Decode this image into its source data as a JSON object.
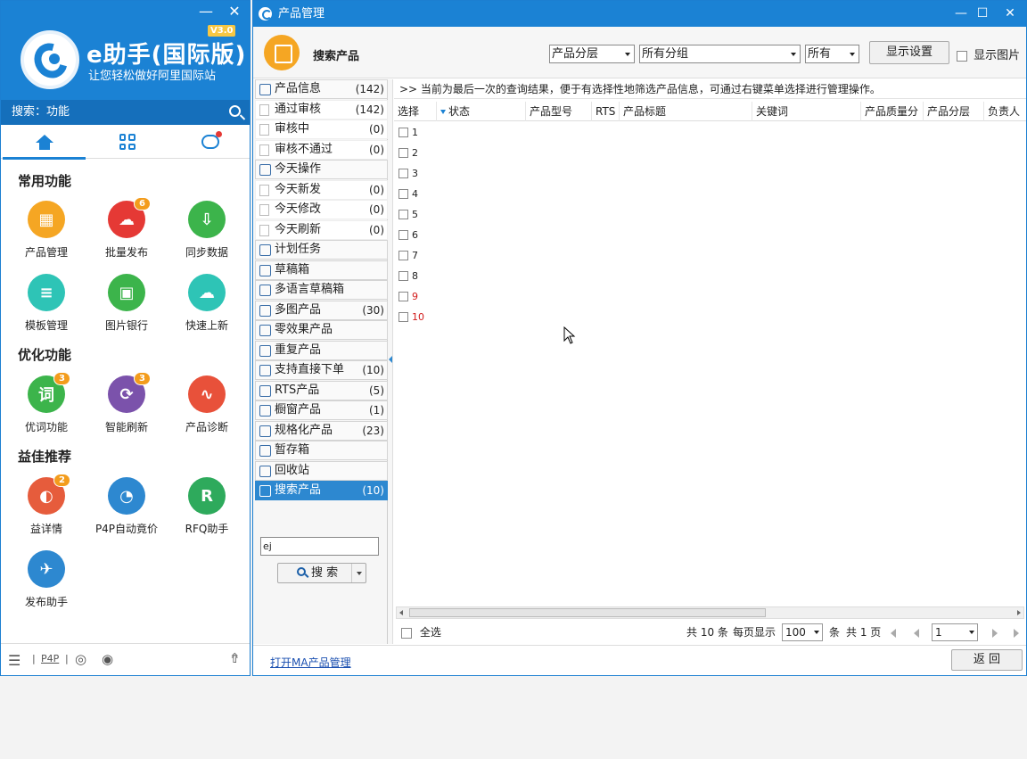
{
  "left_panel": {
    "brand": "e助手(国际版)",
    "version": "V3.0",
    "slogan": "让您轻松做好阿里国际站",
    "search_label": "搜索：功能",
    "sections": {
      "common": "常用功能",
      "optimize": "优化功能",
      "recommend": "益佳推荐"
    },
    "functions": [
      {
        "label": "产品管理",
        "color": "#f5a623",
        "icon": "calendar-icon",
        "badge": ""
      },
      {
        "label": "批量发布",
        "color": "#e53935",
        "icon": "cloud-upload-icon",
        "badge": "6"
      },
      {
        "label": "同步数据",
        "color": "#3cb44b",
        "icon": "download-icon",
        "badge": ""
      },
      {
        "label": "模板管理",
        "color": "#2ec4b6",
        "icon": "list-icon",
        "badge": ""
      },
      {
        "label": "图片银行",
        "color": "#3cb44b",
        "icon": "image-icon",
        "badge": ""
      },
      {
        "label": "快速上新",
        "color": "#2ec4b6",
        "icon": "cloud-icon",
        "badge": ""
      },
      {
        "label": "优词功能",
        "color": "#3cb44b",
        "icon": "word-icon",
        "badge": "3"
      },
      {
        "label": "智能刷新",
        "color": "#7b52ab",
        "icon": "refresh-icon",
        "badge": "3"
      },
      {
        "label": "产品诊断",
        "color": "#e8513a",
        "icon": "stethoscope-icon",
        "badge": ""
      },
      {
        "label": "益详情",
        "color": "#e65c3c",
        "icon": "chrome-icon",
        "badge": "2"
      },
      {
        "label": "P4P自动竟价",
        "color": "#2d88d0",
        "icon": "gauge-icon",
        "badge": ""
      },
      {
        "label": "RFQ助手",
        "color": "#2eaa5c",
        "icon": "r-icon",
        "badge": ""
      },
      {
        "label": "发布助手",
        "color": "#2d88d0",
        "icon": "bird-icon",
        "badge": ""
      }
    ],
    "footer": {
      "p4p": "P4P"
    }
  },
  "main": {
    "title": "产品管理",
    "toolbar": {
      "title": "搜索产品",
      "sel_layer": "产品分层",
      "sel_group": "所有分组",
      "sel_all": "所有",
      "display_settings": "显示设置",
      "show_images": "显示图片"
    },
    "categories": [
      {
        "label": "产品信息",
        "count": "(142)",
        "sub": false,
        "active": false
      },
      {
        "label": "通过审核",
        "count": "(142)",
        "sub": true,
        "active": false
      },
      {
        "label": "审核中",
        "count": "(0)",
        "sub": true,
        "active": false
      },
      {
        "label": "审核不通过",
        "count": "(0)",
        "sub": true,
        "active": false
      },
      {
        "label": "今天操作",
        "count": "",
        "sub": false,
        "active": false
      },
      {
        "label": "今天新发",
        "count": "(0)",
        "sub": true,
        "active": false
      },
      {
        "label": "今天修改",
        "count": "(0)",
        "sub": true,
        "active": false
      },
      {
        "label": "今天刷新",
        "count": "(0)",
        "sub": true,
        "active": false
      },
      {
        "label": "计划任务",
        "count": "",
        "sub": false,
        "active": false
      },
      {
        "label": "草稿箱",
        "count": "",
        "sub": false,
        "active": false
      },
      {
        "label": "多语言草稿箱",
        "count": "",
        "sub": false,
        "active": false
      },
      {
        "label": "多图产品",
        "count": "(30)",
        "sub": false,
        "active": false
      },
      {
        "label": "零效果产品",
        "count": "",
        "sub": false,
        "active": false
      },
      {
        "label": "重复产品",
        "count": "",
        "sub": false,
        "active": false
      },
      {
        "label": "支持直接下单",
        "count": "(10)",
        "sub": false,
        "active": false
      },
      {
        "label": "RTS产品",
        "count": "(5)",
        "sub": false,
        "active": false
      },
      {
        "label": "橱窗产品",
        "count": "(1)",
        "sub": false,
        "active": false
      },
      {
        "label": "规格化产品",
        "count": "(23)",
        "sub": false,
        "active": false
      },
      {
        "label": "暂存箱",
        "count": "",
        "sub": false,
        "active": false
      },
      {
        "label": "回收站",
        "count": "",
        "sub": false,
        "active": false
      },
      {
        "label": "搜索产品",
        "count": "(10)",
        "sub": false,
        "active": true
      }
    ],
    "search_value": "ej",
    "search_button": "搜 索",
    "notice": ">> 当前为最后一次的查询结果，便于有选择性地筛选产品信息，可通过右键菜单选择进行管理操作。",
    "columns": [
      "选择",
      "状态",
      "产品型号",
      "RTS",
      "产品标题",
      "关键词",
      "产品质量分",
      "产品分层",
      "负责人"
    ],
    "rows": [
      {
        "no": "1",
        "status": "",
        "model": "",
        "rts": "",
        "title": "",
        "keyword": "",
        "owner": "",
        "red": false
      },
      {
        "no": "2",
        "status": "",
        "model": "",
        "rts": "",
        "title": "",
        "keyword": "",
        "owner": "",
        "red": false
      },
      {
        "no": "3",
        "status": "",
        "model": "",
        "rts": "",
        "title": "",
        "keyword": "",
        "owner": "",
        "red": false
      },
      {
        "no": "4",
        "status": "",
        "model": "",
        "rts": "",
        "title": "",
        "keyword": "",
        "owner": "",
        "red": false
      },
      {
        "no": "5",
        "status": "",
        "model": "",
        "rts": "",
        "title": "",
        "keyword": "",
        "owner": "",
        "red": false
      },
      {
        "no": "6",
        "status": "",
        "model": "",
        "rts": "",
        "title": "",
        "keyword": "",
        "owner": "",
        "red": false
      },
      {
        "no": "7",
        "status": "",
        "model": "",
        "rts": "",
        "title": "",
        "keyword": "",
        "owner": "",
        "red": false
      },
      {
        "no": "8",
        "status": "",
        "model": "",
        "rts": "",
        "title": "",
        "keyword": "",
        "owner": "",
        "red": false
      },
      {
        "no": "9",
        "status": "",
        "model": "",
        "rts": "",
        "title": "",
        "keyword": "",
        "owner": "",
        "red": true
      },
      {
        "no": "10",
        "status": "",
        "model": "",
        "rts": "",
        "title": "",
        "keyword": "",
        "owner": "",
        "red": true
      }
    ],
    "pager": {
      "select_all": "全选",
      "total": "共 10 条",
      "per_page_label": "每页显示",
      "per_page": "100",
      "unit": "条",
      "pages": "共 1 页",
      "current_page": "1"
    },
    "open_ma": "打开MA产品管理",
    "back": "返 回"
  }
}
